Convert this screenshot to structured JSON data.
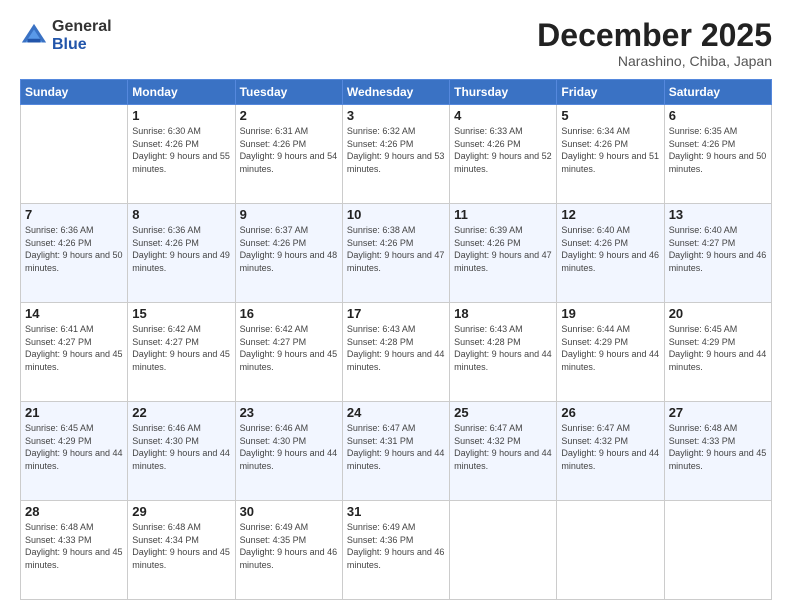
{
  "logo": {
    "general": "General",
    "blue": "Blue"
  },
  "header": {
    "month": "December 2025",
    "location": "Narashino, Chiba, Japan"
  },
  "days_of_week": [
    "Sunday",
    "Monday",
    "Tuesday",
    "Wednesday",
    "Thursday",
    "Friday",
    "Saturday"
  ],
  "weeks": [
    [
      {
        "day": "",
        "sunrise": "",
        "sunset": "",
        "daylight": ""
      },
      {
        "day": "1",
        "sunrise": "Sunrise: 6:30 AM",
        "sunset": "Sunset: 4:26 PM",
        "daylight": "Daylight: 9 hours and 55 minutes."
      },
      {
        "day": "2",
        "sunrise": "Sunrise: 6:31 AM",
        "sunset": "Sunset: 4:26 PM",
        "daylight": "Daylight: 9 hours and 54 minutes."
      },
      {
        "day": "3",
        "sunrise": "Sunrise: 6:32 AM",
        "sunset": "Sunset: 4:26 PM",
        "daylight": "Daylight: 9 hours and 53 minutes."
      },
      {
        "day": "4",
        "sunrise": "Sunrise: 6:33 AM",
        "sunset": "Sunset: 4:26 PM",
        "daylight": "Daylight: 9 hours and 52 minutes."
      },
      {
        "day": "5",
        "sunrise": "Sunrise: 6:34 AM",
        "sunset": "Sunset: 4:26 PM",
        "daylight": "Daylight: 9 hours and 51 minutes."
      },
      {
        "day": "6",
        "sunrise": "Sunrise: 6:35 AM",
        "sunset": "Sunset: 4:26 PM",
        "daylight": "Daylight: 9 hours and 50 minutes."
      }
    ],
    [
      {
        "day": "7",
        "sunrise": "Sunrise: 6:36 AM",
        "sunset": "Sunset: 4:26 PM",
        "daylight": "Daylight: 9 hours and 50 minutes."
      },
      {
        "day": "8",
        "sunrise": "Sunrise: 6:36 AM",
        "sunset": "Sunset: 4:26 PM",
        "daylight": "Daylight: 9 hours and 49 minutes."
      },
      {
        "day": "9",
        "sunrise": "Sunrise: 6:37 AM",
        "sunset": "Sunset: 4:26 PM",
        "daylight": "Daylight: 9 hours and 48 minutes."
      },
      {
        "day": "10",
        "sunrise": "Sunrise: 6:38 AM",
        "sunset": "Sunset: 4:26 PM",
        "daylight": "Daylight: 9 hours and 47 minutes."
      },
      {
        "day": "11",
        "sunrise": "Sunrise: 6:39 AM",
        "sunset": "Sunset: 4:26 PM",
        "daylight": "Daylight: 9 hours and 47 minutes."
      },
      {
        "day": "12",
        "sunrise": "Sunrise: 6:40 AM",
        "sunset": "Sunset: 4:26 PM",
        "daylight": "Daylight: 9 hours and 46 minutes."
      },
      {
        "day": "13",
        "sunrise": "Sunrise: 6:40 AM",
        "sunset": "Sunset: 4:27 PM",
        "daylight": "Daylight: 9 hours and 46 minutes."
      }
    ],
    [
      {
        "day": "14",
        "sunrise": "Sunrise: 6:41 AM",
        "sunset": "Sunset: 4:27 PM",
        "daylight": "Daylight: 9 hours and 45 minutes."
      },
      {
        "day": "15",
        "sunrise": "Sunrise: 6:42 AM",
        "sunset": "Sunset: 4:27 PM",
        "daylight": "Daylight: 9 hours and 45 minutes."
      },
      {
        "day": "16",
        "sunrise": "Sunrise: 6:42 AM",
        "sunset": "Sunset: 4:27 PM",
        "daylight": "Daylight: 9 hours and 45 minutes."
      },
      {
        "day": "17",
        "sunrise": "Sunrise: 6:43 AM",
        "sunset": "Sunset: 4:28 PM",
        "daylight": "Daylight: 9 hours and 44 minutes."
      },
      {
        "day": "18",
        "sunrise": "Sunrise: 6:43 AM",
        "sunset": "Sunset: 4:28 PM",
        "daylight": "Daylight: 9 hours and 44 minutes."
      },
      {
        "day": "19",
        "sunrise": "Sunrise: 6:44 AM",
        "sunset": "Sunset: 4:29 PM",
        "daylight": "Daylight: 9 hours and 44 minutes."
      },
      {
        "day": "20",
        "sunrise": "Sunrise: 6:45 AM",
        "sunset": "Sunset: 4:29 PM",
        "daylight": "Daylight: 9 hours and 44 minutes."
      }
    ],
    [
      {
        "day": "21",
        "sunrise": "Sunrise: 6:45 AM",
        "sunset": "Sunset: 4:29 PM",
        "daylight": "Daylight: 9 hours and 44 minutes."
      },
      {
        "day": "22",
        "sunrise": "Sunrise: 6:46 AM",
        "sunset": "Sunset: 4:30 PM",
        "daylight": "Daylight: 9 hours and 44 minutes."
      },
      {
        "day": "23",
        "sunrise": "Sunrise: 6:46 AM",
        "sunset": "Sunset: 4:30 PM",
        "daylight": "Daylight: 9 hours and 44 minutes."
      },
      {
        "day": "24",
        "sunrise": "Sunrise: 6:47 AM",
        "sunset": "Sunset: 4:31 PM",
        "daylight": "Daylight: 9 hours and 44 minutes."
      },
      {
        "day": "25",
        "sunrise": "Sunrise: 6:47 AM",
        "sunset": "Sunset: 4:32 PM",
        "daylight": "Daylight: 9 hours and 44 minutes."
      },
      {
        "day": "26",
        "sunrise": "Sunrise: 6:47 AM",
        "sunset": "Sunset: 4:32 PM",
        "daylight": "Daylight: 9 hours and 44 minutes."
      },
      {
        "day": "27",
        "sunrise": "Sunrise: 6:48 AM",
        "sunset": "Sunset: 4:33 PM",
        "daylight": "Daylight: 9 hours and 45 minutes."
      }
    ],
    [
      {
        "day": "28",
        "sunrise": "Sunrise: 6:48 AM",
        "sunset": "Sunset: 4:33 PM",
        "daylight": "Daylight: 9 hours and 45 minutes."
      },
      {
        "day": "29",
        "sunrise": "Sunrise: 6:48 AM",
        "sunset": "Sunset: 4:34 PM",
        "daylight": "Daylight: 9 hours and 45 minutes."
      },
      {
        "day": "30",
        "sunrise": "Sunrise: 6:49 AM",
        "sunset": "Sunset: 4:35 PM",
        "daylight": "Daylight: 9 hours and 46 minutes."
      },
      {
        "day": "31",
        "sunrise": "Sunrise: 6:49 AM",
        "sunset": "Sunset: 4:36 PM",
        "daylight": "Daylight: 9 hours and 46 minutes."
      },
      {
        "day": "",
        "sunrise": "",
        "sunset": "",
        "daylight": ""
      },
      {
        "day": "",
        "sunrise": "",
        "sunset": "",
        "daylight": ""
      },
      {
        "day": "",
        "sunrise": "",
        "sunset": "",
        "daylight": ""
      }
    ]
  ]
}
